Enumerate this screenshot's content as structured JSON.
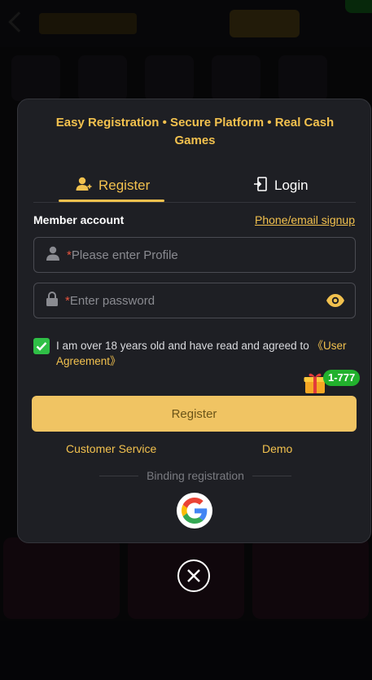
{
  "modal": {
    "headline": "Easy Registration • Secure Platform • Real Cash Games",
    "tabs": [
      {
        "label": "Register",
        "icon": "user-add-icon",
        "active": true
      },
      {
        "label": "Login",
        "icon": "login-door-icon",
        "active": false
      }
    ],
    "member_label": "Member account",
    "alt_signup_link": "Phone/email signup",
    "username": {
      "value": "",
      "placeholder": "Please enter Profile",
      "required_mark": "*"
    },
    "password": {
      "value": "",
      "placeholder": "Enter password",
      "required_mark": "*"
    },
    "agreement": {
      "checked": true,
      "text": "I am over 18 years old and have read and agreed to ",
      "link": "《User Agreement》"
    },
    "bonus_badge": "1-777",
    "register_button": "Register",
    "customer_service": "Customer Service",
    "demo": "Demo",
    "binding_label": "Binding registration",
    "social": [
      "google-icon"
    ]
  },
  "colors": {
    "accent": "#f2c14e",
    "button": "#f0c463",
    "checkbox": "#2fbf46",
    "required": "#e5533d",
    "badge": "#22b12d",
    "modal_bg": "#1e1f24"
  }
}
